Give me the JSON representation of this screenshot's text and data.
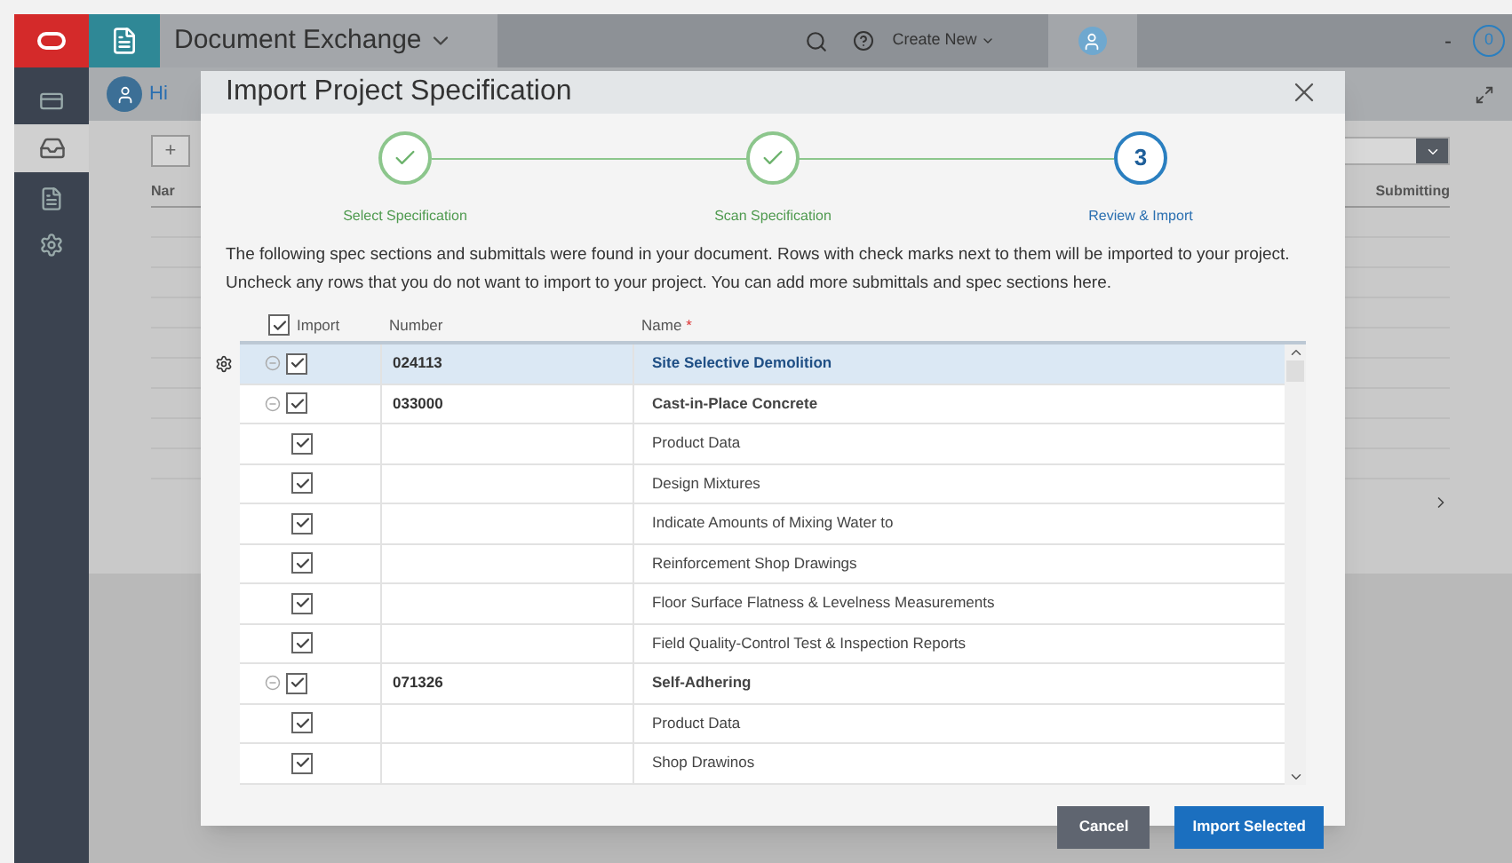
{
  "app_bar": {
    "title": "Document Exchange",
    "create_button": "Create New",
    "notifications": "0",
    "menu": "-"
  },
  "project_bar": {
    "name": "Hi"
  },
  "background_table": {
    "add_button": "+",
    "column_1": "Nar",
    "column_2": "Submitting"
  },
  "dialog": {
    "title": "Import Project Specification",
    "steps": [
      {
        "label": "Select Specification",
        "completed": true
      },
      {
        "label": "Scan Specification",
        "completed": true
      },
      {
        "label": "Review & Import",
        "completed": false,
        "number": "3"
      }
    ],
    "description": "The following spec sections and submittals were found in your document. Rows with check marks next to them will be imported to your project. Uncheck any rows that you do not want to import to your project. You can add more submittals and spec sections here.",
    "table": {
      "select_all_checked": true,
      "columns": [
        "Import",
        "Number",
        "Name"
      ],
      "required_mark": "*",
      "rows": [
        {
          "kind": "section",
          "checked": true,
          "selected": true,
          "number": "024113",
          "name": "Site Selective Demolition"
        },
        {
          "kind": "section",
          "checked": true,
          "selected": false,
          "number": "033000",
          "name": "Cast-in-Place Concrete"
        },
        {
          "kind": "item",
          "checked": true,
          "selected": false,
          "name": "Product Data"
        },
        {
          "kind": "item",
          "checked": true,
          "selected": false,
          "name": "Design Mixtures"
        },
        {
          "kind": "item",
          "checked": true,
          "selected": false,
          "name": "Indicate Amounts of Mixing Water to"
        },
        {
          "kind": "item",
          "checked": true,
          "selected": false,
          "name": "Reinforcement Shop Drawings"
        },
        {
          "kind": "item",
          "checked": true,
          "selected": false,
          "name": "Floor Surface Flatness & Levelness Measurements"
        },
        {
          "kind": "item",
          "checked": true,
          "selected": false,
          "name": "Field Quality-Control Test & Inspection Reports"
        },
        {
          "kind": "section",
          "checked": true,
          "selected": false,
          "number": "071326",
          "name": "Self-Adhering"
        },
        {
          "kind": "item",
          "checked": true,
          "selected": false,
          "name": "Product Data"
        },
        {
          "kind": "item",
          "checked": true,
          "selected": false,
          "name": "Shop Drawinos"
        }
      ]
    },
    "buttons": {
      "cancel": "Cancel",
      "confirm": "Import Selected"
    }
  }
}
